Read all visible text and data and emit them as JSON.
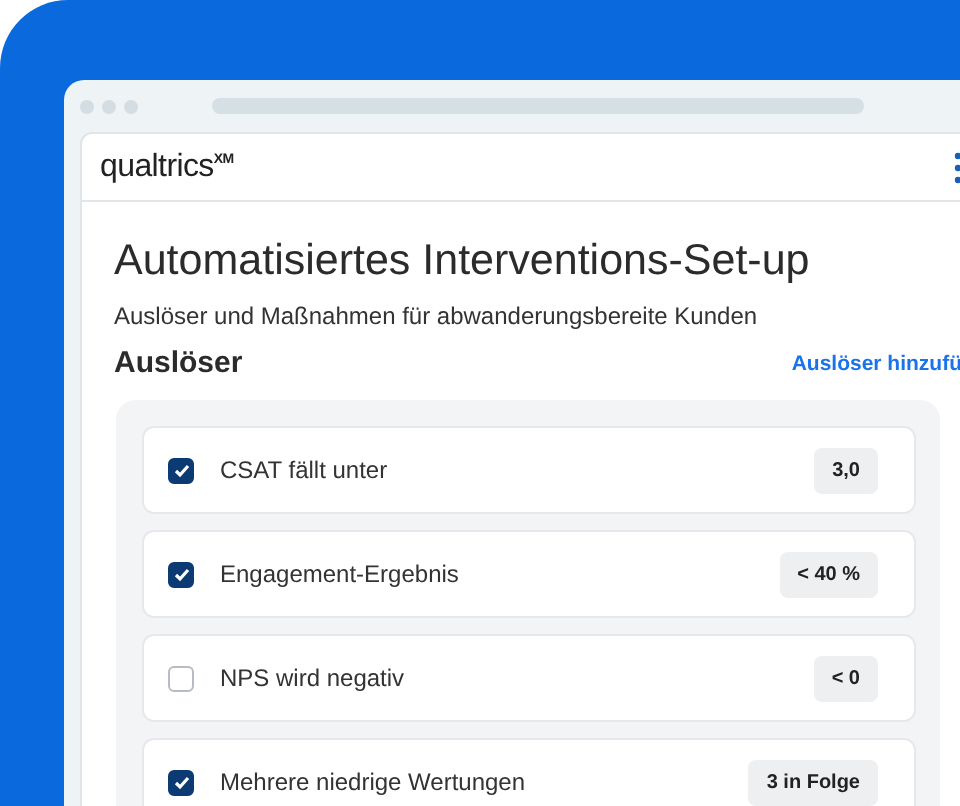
{
  "app": {
    "logo": "qualtrics",
    "logo_mark": "XM"
  },
  "page": {
    "title": "Automatisiertes Interventions-Set-up",
    "subtitle": "Auslöser und Maßnahmen für abwanderungsbereite Kunden"
  },
  "section": {
    "heading": "Auslöser",
    "link": "Auslöser hinzufü"
  },
  "triggers": [
    {
      "label": "CSAT fällt unter",
      "value": "3,0",
      "checked": true
    },
    {
      "label": "Engagement-Ergebnis",
      "value": "< 40 %",
      "checked": true
    },
    {
      "label": "NPS wird negativ",
      "value": "< 0",
      "checked": false
    },
    {
      "label": "Mehrere niedrige Wertungen",
      "value": "3 in Folge",
      "checked": true
    }
  ]
}
